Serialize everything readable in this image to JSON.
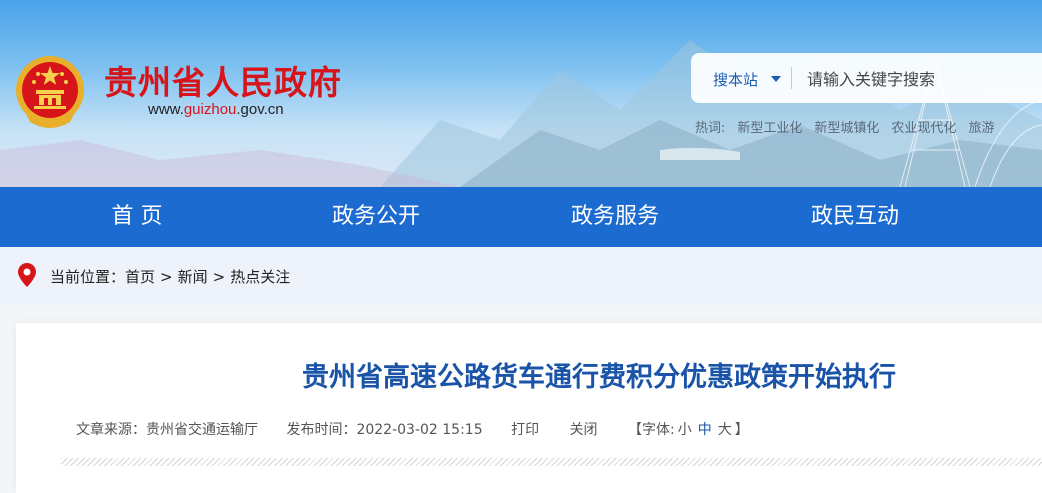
{
  "header": {
    "site_title": "贵州省人民政府",
    "url_prefix": "www.",
    "url_highlight": "guizhou",
    "url_suffix": ".gov.cn",
    "emblem_icon": "national-emblem-icon"
  },
  "search": {
    "scope_label": "搜本站",
    "placeholder": "请输入关键字搜索"
  },
  "hotwords": {
    "label": "热词:",
    "items": [
      "新型工业化",
      "新型城镇化",
      "农业现代化",
      "旅游"
    ]
  },
  "nav": {
    "items": [
      "首 页",
      "政务公开",
      "政务服务",
      "政民互动"
    ]
  },
  "breadcrumb": {
    "prefix": "当前位置：",
    "items": [
      "首页",
      "新闻",
      "热点关注"
    ],
    "separator": ">"
  },
  "article": {
    "title": "贵州省高速公路货车通行费积分优惠政策开始执行",
    "source_label": "文章来源：贵州省交通运输厅",
    "date_label": "发布时间：2022-03-02 15:15",
    "print_label": "打印",
    "close_label": "关闭",
    "font_prefix": "【字体:",
    "font_small": "小",
    "font_medium": "中",
    "font_large": "大",
    "font_suffix": "】"
  },
  "colors": {
    "brand_red": "#d8141b",
    "nav_blue": "#1c6bd1",
    "title_blue": "#1a54a8"
  }
}
